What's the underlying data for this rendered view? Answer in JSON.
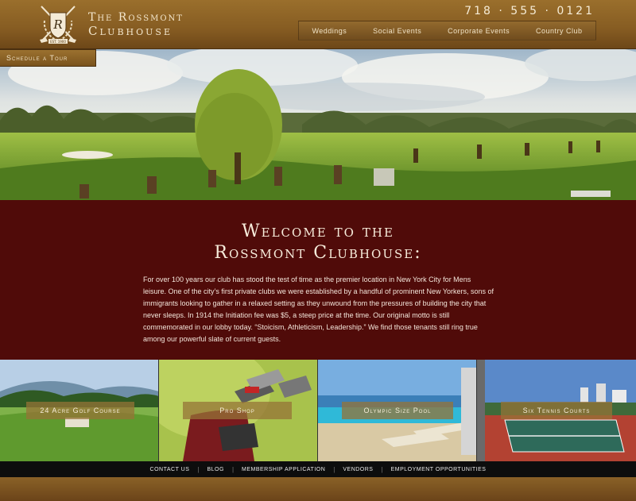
{
  "header": {
    "brand_line1": "The Rossmont",
    "brand_line2": "Clubhouse",
    "crest_letter": "R",
    "crest_est": "EST. 1900",
    "phone": "718 · 555 · 0121",
    "nav": [
      "Weddings",
      "Social Events",
      "Corporate Events",
      "Country Club"
    ]
  },
  "hero": {
    "schedule_label": "Schedule a Tour"
  },
  "welcome": {
    "title_line1": "Welcome to the",
    "title_line2": "Rossmont Clubhouse:",
    "body": "For over 100 years our club has stood the test of time as the premier location in New York City for Mens leisure. One of the city’s first private clubs we were established by a handful of prominent New Yorkers, sons of immigrants looking to gather in a relaxed setting as they unwound from the pressures of building the city that never sleeps. In 1914 the Initiation fee was $5, a steep price at the time. Our original motto is still commemorated in our lobby today. “Stoicism, Athleticism, Leadership.” We find those tenants still ring true among our powerful slate of current guests."
  },
  "tiles": [
    "24 Acre Golf Course",
    "Pro Shop",
    "Olympic Size Pool",
    "Six Tennis Courts"
  ],
  "footer": [
    "CONTACT US",
    "BLOG",
    "MEMBERSHIP APPLICATION",
    "VENDORS",
    "EMPLOYMENT OPPORTUNITIES"
  ],
  "colors": {
    "header_brown": "#865c22",
    "welcome_maroon": "#500b09",
    "footer_black": "#0d0d0d"
  }
}
